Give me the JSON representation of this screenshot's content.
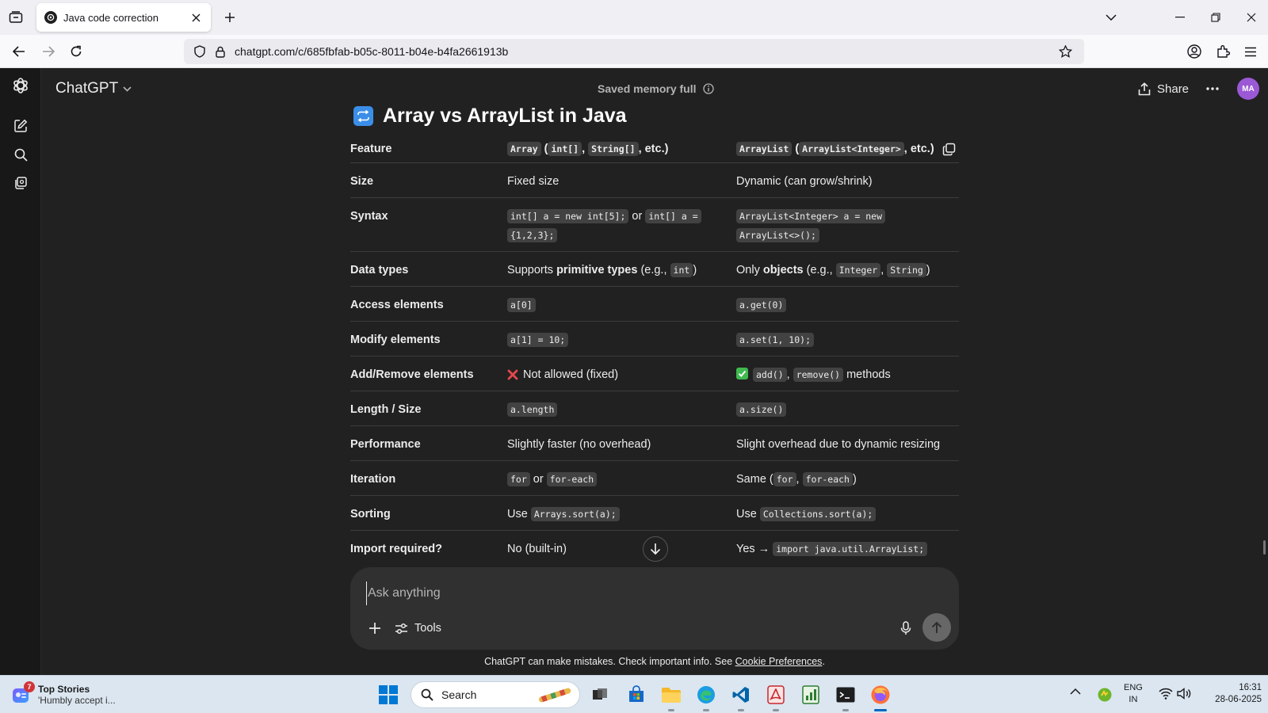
{
  "browser": {
    "tab_title": "Java code correction",
    "url": "chatgpt.com/c/685fbfab-b05c-8011-b04e-b4fa2661913b"
  },
  "app": {
    "model_name": "ChatGPT",
    "memory_status": "Saved memory full",
    "share_label": "Share",
    "avatar_initials": "MA"
  },
  "content": {
    "heading": "Array vs ArrayList in Java"
  },
  "table": {
    "header": {
      "feature": "Feature",
      "array_code": "Array",
      "array_pre": " (",
      "array_code2": "int[]",
      "array_sep": ", ",
      "array_code3": "String[]",
      "array_post": ", etc.)",
      "arraylist_code": "ArrayList",
      "arraylist_pre": " (",
      "arraylist_code2": "ArrayList<Integer>",
      "arraylist_post": ", etc.)"
    },
    "rows": {
      "size": {
        "feature": "Size",
        "array": "Fixed size",
        "arraylist": "Dynamic (can grow/shrink)"
      },
      "syntax": {
        "feature": "Syntax",
        "array_code1": "int[] a = new int[5];",
        "array_or": " or ",
        "array_code2a": "int[] a =",
        "array_code2b": "{1,2,3};",
        "arraylist_code1a": "ArrayList<Integer> a = new",
        "arraylist_code1b": "ArrayList<>();"
      },
      "data_types": {
        "feature": "Data types",
        "array_pre": "Supports ",
        "array_bold": "primitive types",
        "array_mid": " (e.g., ",
        "array_code": "int",
        "array_post": ")",
        "arraylist_pre": "Only ",
        "arraylist_bold": "objects",
        "arraylist_mid": " (e.g., ",
        "arraylist_code1": "Integer",
        "arraylist_sep": ", ",
        "arraylist_code2": "String",
        "arraylist_post": ")"
      },
      "access": {
        "feature": "Access elements",
        "array_code": "a[0]",
        "arraylist_code": "a.get(0)"
      },
      "modify": {
        "feature": "Modify elements",
        "array_code": "a[1] = 10;",
        "arraylist_code": "a.set(1, 10);"
      },
      "add_remove": {
        "feature": "Add/Remove elements",
        "array": "Not allowed (fixed)",
        "arraylist_code1": "add()",
        "arraylist_sep": ", ",
        "arraylist_code2": "remove()",
        "arraylist_post": " methods"
      },
      "length": {
        "feature": "Length / Size",
        "array_code": "a.length",
        "arraylist_code": "a.size()"
      },
      "performance": {
        "feature": "Performance",
        "array": "Slightly faster (no overhead)",
        "arraylist": "Slight overhead due to dynamic resizing"
      },
      "iteration": {
        "feature": "Iteration",
        "array_code1": "for",
        "array_or": " or ",
        "array_code2": "for-each",
        "arraylist_pre": "Same (",
        "arraylist_code1": "for",
        "arraylist_sep": ", ",
        "arraylist_code2": "for-each",
        "arraylist_post": ")"
      },
      "sorting": {
        "feature": "Sorting",
        "array_pre": "Use ",
        "array_code": "Arrays.sort(a);",
        "arraylist_pre": "Use ",
        "arraylist_code": "Collections.sort(a);"
      },
      "import": {
        "feature": "Import required?",
        "array": "No (built-in)",
        "arraylist_pre": "Yes → ",
        "arraylist_code": "import java.util.ArrayList;"
      }
    }
  },
  "composer": {
    "placeholder": "Ask anything",
    "tools_label": "Tools"
  },
  "footer": {
    "disclaimer": "ChatGPT can make mistakes. Check important info. See ",
    "cookie_link": "Cookie Preferences",
    "end": "."
  },
  "taskbar": {
    "news_badge": "7",
    "news_title": "Top Stories",
    "news_subtitle": "'Humbly accept i...",
    "search_label": "Search",
    "lang_line1": "ENG",
    "lang_line2": "IN",
    "time": "16:31",
    "date": "28-06-2025"
  }
}
